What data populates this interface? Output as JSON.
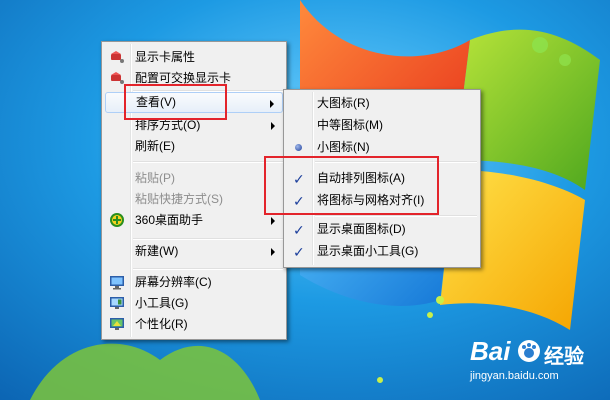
{
  "context_menu": {
    "items": [
      {
        "label": "显示卡属性",
        "icon": "display-card-icon"
      },
      {
        "label": "配置可交换显示卡",
        "icon": "switchable-graphics-icon"
      },
      {
        "label": "查看(V)",
        "submenu": true
      },
      {
        "label": "排序方式(O)",
        "submenu": true
      },
      {
        "label": "刷新(E)"
      },
      {
        "label": "粘贴(P)",
        "disabled": true
      },
      {
        "label": "粘贴快捷方式(S)",
        "disabled": true
      },
      {
        "label": "360桌面助手",
        "icon": "360-assistant-icon",
        "submenu": true
      },
      {
        "label": "新建(W)",
        "submenu": true
      },
      {
        "label": "屏幕分辨率(C)",
        "icon": "screen-resolution-icon"
      },
      {
        "label": "小工具(G)",
        "icon": "gadgets-icon"
      },
      {
        "label": "个性化(R)",
        "icon": "personalize-icon"
      }
    ]
  },
  "view_submenu": {
    "items": [
      {
        "label": "大图标(R)"
      },
      {
        "label": "中等图标(M)"
      },
      {
        "label": "小图标(N)",
        "mark": "radio"
      },
      {
        "label": "自动排列图标(A)",
        "mark": "check"
      },
      {
        "label": "将图标与网格对齐(I)",
        "mark": "check"
      },
      {
        "label": "显示桌面图标(D)",
        "mark": "check"
      },
      {
        "label": "显示桌面小工具(G)",
        "mark": "check"
      }
    ]
  },
  "marks": {
    "check": "✓"
  },
  "watermark": {
    "brand": "Bai",
    "brand_suffix": "经验",
    "url": "jingyan.baidu.com"
  },
  "colors": {
    "desktop": "#1e8fd6",
    "highlight_box": "#e3242b",
    "menu_bg": "#f0f0f0"
  }
}
